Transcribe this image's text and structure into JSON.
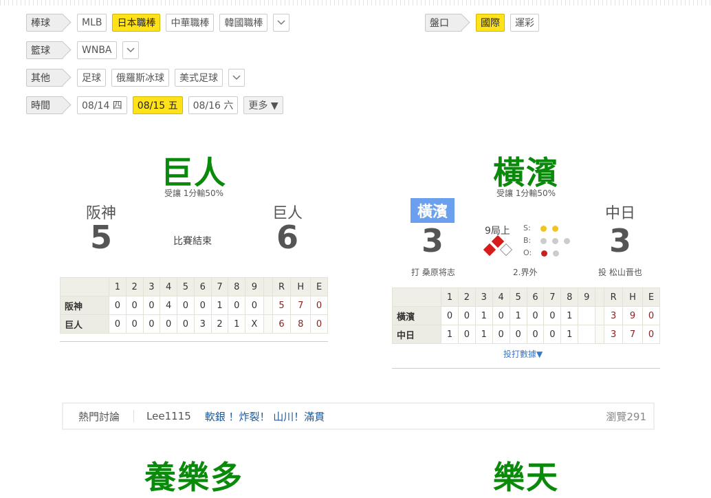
{
  "filters": {
    "baseball": {
      "label": "棒球",
      "items": [
        "MLB",
        "日本職棒",
        "中華職棒",
        "韓國職棒"
      ],
      "active": "日本職棒"
    },
    "odds": {
      "label": "盤口",
      "items": [
        "國際",
        "運彩"
      ],
      "active": "國際"
    },
    "basketball": {
      "label": "籃球",
      "items": [
        "WNBA"
      ]
    },
    "other": {
      "label": "其他",
      "items": [
        "足球",
        "俄羅斯冰球",
        "美式足球"
      ]
    },
    "time": {
      "label": "時間",
      "items": [
        "08/14 四",
        "08/15 五",
        "08/16 六"
      ],
      "active": "08/15 五",
      "more": "更多 ▼"
    }
  },
  "game1": {
    "pick": "巨人",
    "handicap": "受讓 1分輸50%",
    "away": {
      "name": "阪神",
      "score": "5"
    },
    "home": {
      "name": "巨人",
      "score": "6"
    },
    "status": "比賽結束",
    "innings": [
      "1",
      "2",
      "3",
      "4",
      "5",
      "6",
      "7",
      "8",
      "9"
    ],
    "rhe_head": [
      "R",
      "H",
      "E"
    ],
    "rows": [
      {
        "team": "阪神",
        "innings": [
          "0",
          "0",
          "0",
          "4",
          "0",
          "0",
          "1",
          "0",
          "0"
        ],
        "rhe": [
          "5",
          "7",
          "0"
        ]
      },
      {
        "team": "巨人",
        "innings": [
          "0",
          "0",
          "0",
          "0",
          "0",
          "3",
          "2",
          "1",
          "X"
        ],
        "rhe": [
          "6",
          "8",
          "0"
        ]
      }
    ]
  },
  "game2": {
    "pick": "橫濱",
    "handicap": "受讓 1分輸50%",
    "away": {
      "name": "橫濱",
      "score": "3"
    },
    "home": {
      "name": "中日",
      "score": "3"
    },
    "inning": "9局上",
    "sbo": {
      "s": "S:",
      "b": "B:",
      "o": "O:"
    },
    "batter": "打 桑原将志",
    "play": "2.界外",
    "pitcher": "投 松山晋也",
    "innings": [
      "1",
      "2",
      "3",
      "4",
      "5",
      "6",
      "7",
      "8",
      "9"
    ],
    "rhe_head": [
      "R",
      "H",
      "E"
    ],
    "rows": [
      {
        "team": "橫濱",
        "innings": [
          "0",
          "0",
          "1",
          "0",
          "1",
          "0",
          "0",
          "1",
          ""
        ],
        "rhe": [
          "3",
          "9",
          "0"
        ]
      },
      {
        "team": "中日",
        "innings": [
          "1",
          "0",
          "1",
          "0",
          "0",
          "0",
          "0",
          "1",
          ""
        ],
        "rhe": [
          "3",
          "7",
          "0"
        ]
      }
    ],
    "batting_link": "投打數據▼"
  },
  "hot": {
    "label": "熱門討論",
    "user": "Lee1115",
    "text": "軟銀 ！炸裂！ 山川！滿貫",
    "views": "瀏覽291"
  },
  "next": {
    "left": "養樂多",
    "right": "樂天"
  },
  "colors": {
    "active": "#ffe21a",
    "pick": "#0a8a0a",
    "batting": "#6ba0ee",
    "rhe": "#8b1d1d",
    "link": "#3a77c7"
  }
}
